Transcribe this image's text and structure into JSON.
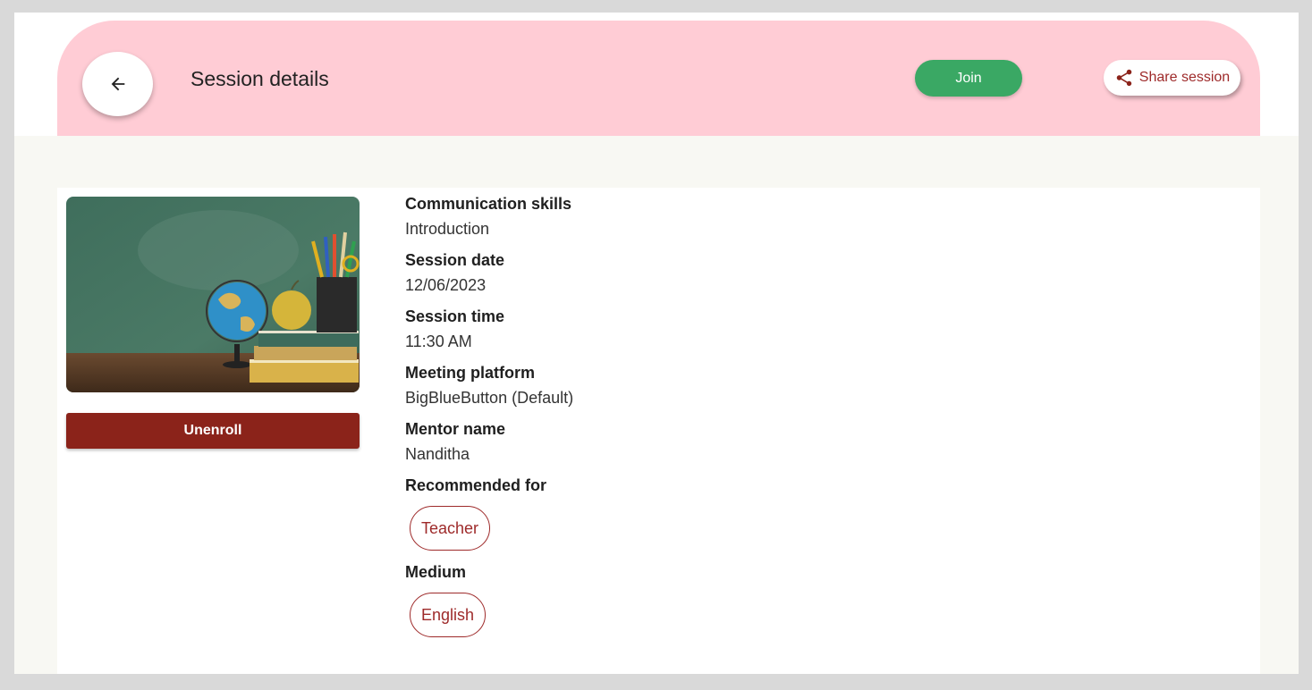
{
  "header": {
    "title": "Session details",
    "join_label": "Join",
    "share_label": "Share session"
  },
  "session": {
    "image_icon": "classroom-image",
    "unenroll_label": "Unenroll",
    "fields": [
      {
        "label": "Communication skills",
        "value": "Introduction"
      },
      {
        "label": "Session date",
        "value": "12/06/2023"
      },
      {
        "label": "Session time",
        "value": "11:30 AM"
      },
      {
        "label": "Meeting platform",
        "value": "BigBlueButton (Default)"
      },
      {
        "label": "Mentor name",
        "value": "Nanditha"
      }
    ],
    "recommended_label": "Recommended for",
    "recommended_chips": [
      "Teacher"
    ],
    "medium_label": "Medium",
    "medium_chips": [
      "English"
    ]
  },
  "colors": {
    "header_bg": "#ffccd5",
    "join_bg": "#3aa864",
    "unenroll_bg": "#8b231a",
    "accent": "#9e2a2a"
  }
}
